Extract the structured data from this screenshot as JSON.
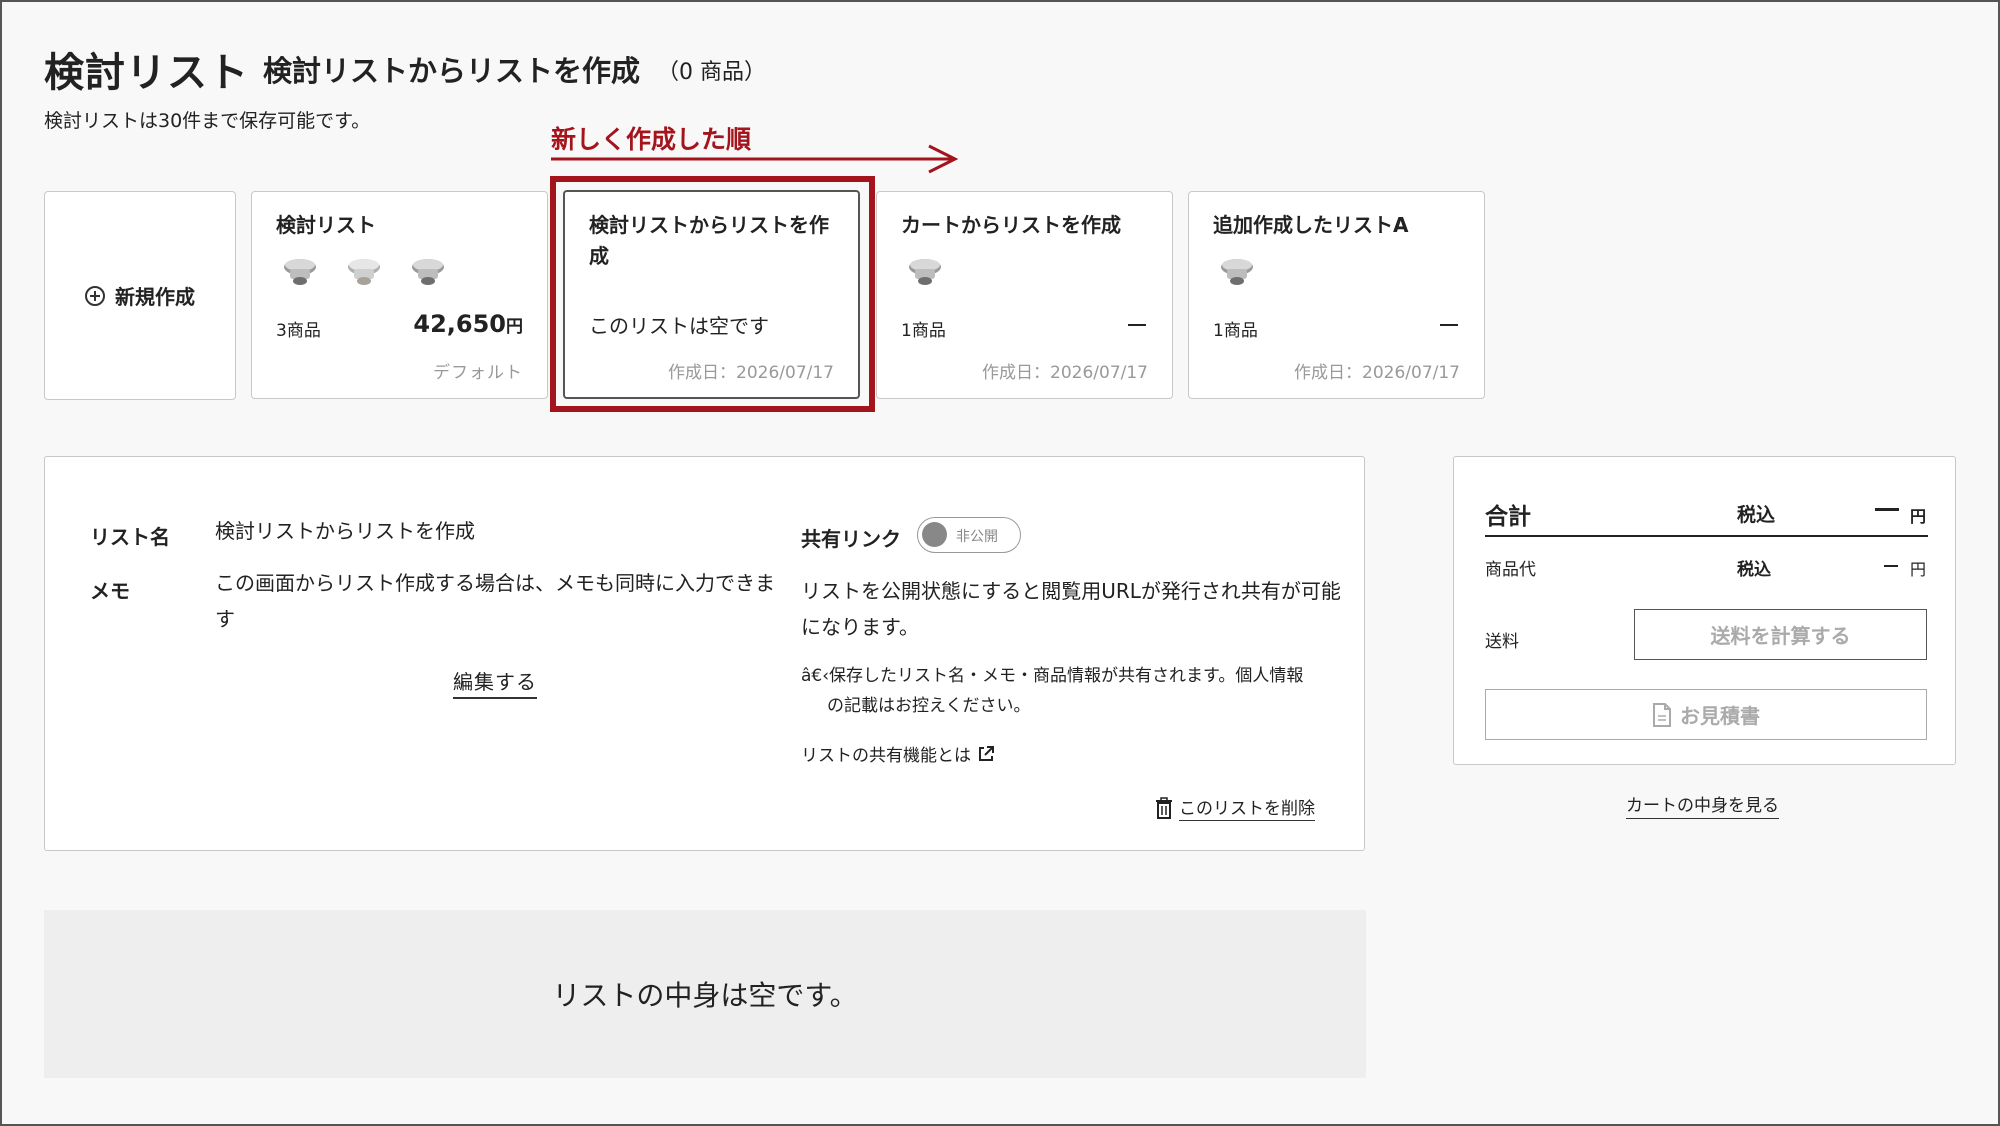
{
  "header": {
    "title": "検討リスト",
    "subtitle": "検討リストからリストを作成",
    "count": "（0 商品）",
    "note": "検討リストは30件まで保存可能です。"
  },
  "annotation": {
    "label": "新しく作成した順",
    "color": "#a3141c"
  },
  "new_card": {
    "label": "新規作成",
    "icon": "plus-circle-icon"
  },
  "cards": [
    {
      "title": "検討リスト",
      "count": "3商品",
      "price": "42,650",
      "yen": "円",
      "footer": "デフォルト"
    },
    {
      "title": "検討リストからリストを作成",
      "empty": "このリストは空です",
      "footer": "作成日：2026/07/17"
    },
    {
      "title": "カートからリストを作成",
      "count": "1商品",
      "footer": "作成日：2026/07/17"
    },
    {
      "title": "追加作成したリストA",
      "count": "1商品",
      "footer": "作成日：2026/07/17"
    }
  ],
  "detail": {
    "name_label": "リスト名",
    "name_value": "検討リストからリストを作成",
    "memo_label": "メモ",
    "memo_value": "この画面からリスト作成する場合は、メモも同時に入力できます",
    "edit_label": "編集する",
    "share_label": "共有リンク",
    "toggle_text": "非公開",
    "share_desc": "リストを公開状態にすると閲覧用URLが発行され共有が可能になります。",
    "share_note_line1": "â€‹保存したリスト名・メモ・商品情報が共有されます。個人情報",
    "share_note_line2": "の記載はお控えください。",
    "share_about": "リストの共有機能とは",
    "delete_label": "このリストを削除"
  },
  "summary": {
    "total_label": "合計",
    "tax_label": "税込",
    "yen": "円",
    "item_label": "商品代",
    "item_tax_label": "税込",
    "shipping_label": "送料",
    "shipping_button": "送料を計算する",
    "quote_button": "お見積書",
    "cart_link": "カートの中身を見る"
  },
  "empty_message": "リストの中身は空です。"
}
